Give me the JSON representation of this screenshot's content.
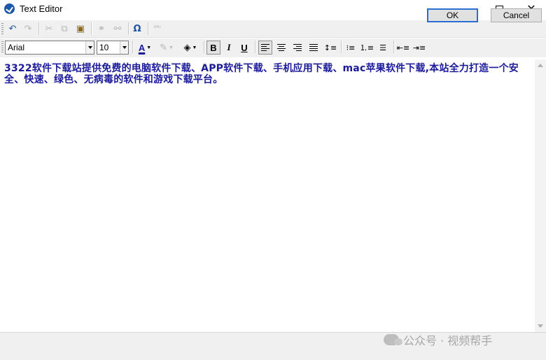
{
  "window": {
    "title": "Text Editor"
  },
  "toolbar_top": {
    "items": [
      {
        "name": "undo-icon",
        "glyph": "↶",
        "enabled": true
      },
      {
        "name": "redo-icon",
        "glyph": "↷",
        "enabled": false
      },
      {
        "name": "cut-icon",
        "glyph": "✂",
        "enabled": false
      },
      {
        "name": "copy-icon",
        "glyph": "⧉",
        "enabled": false
      },
      {
        "name": "paste-icon",
        "glyph": "📋",
        "enabled": true
      },
      {
        "name": "insert-link-icon",
        "glyph": "⚭",
        "enabled": false
      },
      {
        "name": "remove-link-icon",
        "glyph": "⚯",
        "enabled": false
      },
      {
        "name": "insert-symbol-icon",
        "glyph": "Ω",
        "enabled": true
      },
      {
        "name": "spellcheck-icon",
        "glyph": "ᴬᴮᶜ✓",
        "enabled": false
      }
    ]
  },
  "format_bar": {
    "font_name": "Arial",
    "font_size": "10",
    "font_color_glyph": "A",
    "font_color": "#1a1a9a",
    "highlight_glyph": "✎",
    "fill_glyph": "◈",
    "bold": "B",
    "italic": "I",
    "underline": "U"
  },
  "editor": {
    "content": "3322软件下载站提供免费的电脑软件下载、APP软件下载、手机应用下载、mac苹果软件下载,本站全力打造一个安全、快速、绿色、无病毒的软件和游戏下载平台。"
  },
  "buttons": {
    "ok": "OK",
    "cancel": "Cancel"
  },
  "watermark": {
    "text": "公众号 · 视频帮手"
  }
}
